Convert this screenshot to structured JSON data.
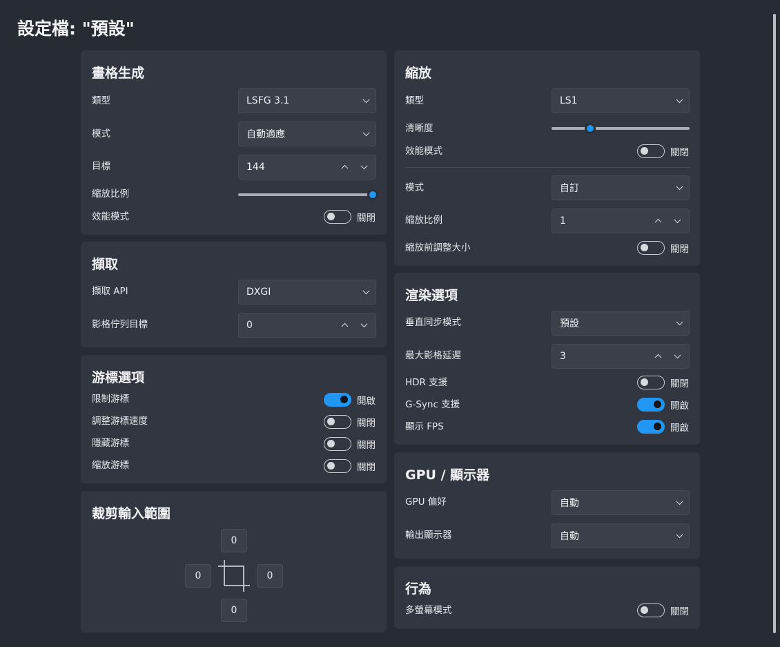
{
  "page": {
    "title": "設定檔: \"預設\""
  },
  "framegen": {
    "title": "畫格生成",
    "type_label": "類型",
    "type_value": "LSFG 3.1",
    "mode_label": "模式",
    "mode_value": "自動適應",
    "target_label": "目標",
    "target_value": "144",
    "scale_label": "縮放比例",
    "scale_fraction": 1.0,
    "perf_label": "效能模式",
    "perf_state": "關閉",
    "perf_on": false
  },
  "capture": {
    "title": "擷取",
    "api_label": "擷取 API",
    "api_value": "DXGI",
    "queue_label": "影格佇列目標",
    "queue_value": "0"
  },
  "cursor": {
    "title": "游標選項",
    "items": [
      {
        "label": "限制游標",
        "state": "開啟",
        "on": true
      },
      {
        "label": "調整游標速度",
        "state": "關閉",
        "on": false
      },
      {
        "label": "隱藏游標",
        "state": "關閉",
        "on": false
      },
      {
        "label": "縮放游標",
        "state": "關閉",
        "on": false
      }
    ]
  },
  "crop": {
    "title": "裁剪輸入範圍",
    "top": "0",
    "left": "0",
    "right": "0",
    "bottom": "0",
    "icon": "crop-icon"
  },
  "scaling": {
    "title": "縮放",
    "type_label": "類型",
    "type_value": "LS1",
    "sharpness_label": "清晰度",
    "sharpness_fraction": 0.27,
    "perf_label": "效能模式",
    "perf_state": "關閉",
    "perf_on": false,
    "mode_label": "模式",
    "mode_value": "自訂",
    "factor_label": "縮放比例",
    "factor_value": "1",
    "prescale_label": "縮放前調整大小",
    "prescale_state": "關閉",
    "prescale_on": false
  },
  "render": {
    "title": "渲染選項",
    "vsync_label": "垂直同步模式",
    "vsync_value": "預設",
    "latency_label": "最大影格延遲",
    "latency_value": "3",
    "hdr_label": "HDR 支援",
    "hdr_state": "關閉",
    "hdr_on": false,
    "gsync_label": "G-Sync 支援",
    "gsync_state": "開啟",
    "gsync_on": true,
    "fps_label": "顯示 FPS",
    "fps_state": "開啟",
    "fps_on": true
  },
  "gpu": {
    "title": "GPU / 顯示器",
    "pref_label": "GPU 偏好",
    "pref_value": "自動",
    "output_label": "輸出顯示器",
    "output_value": "自動"
  },
  "behavior": {
    "title": "行為",
    "multi_label": "多螢幕模式",
    "multi_state": "關閉",
    "multi_on": false
  },
  "colors": {
    "accent": "#2196f3",
    "card": "#323640",
    "background": "#272b33"
  }
}
